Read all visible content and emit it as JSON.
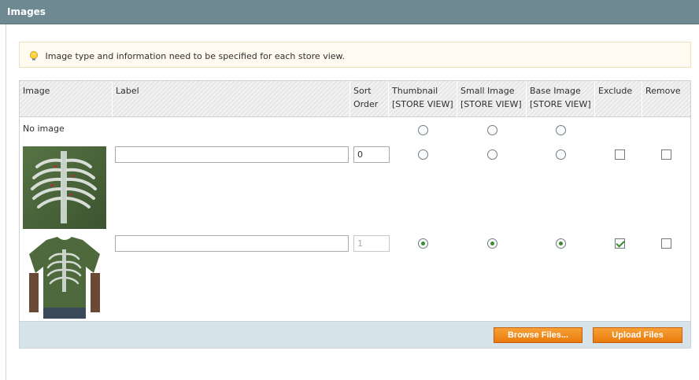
{
  "panel": {
    "title": "Images"
  },
  "notice": {
    "icon": "lightbulb-icon",
    "text": "Image type and information need to be specified for each store view."
  },
  "table": {
    "headers": {
      "image": "Image",
      "label": "Label",
      "sort_line1": "Sort",
      "sort_line2": "Order",
      "thumb_line1": "Thumbnail",
      "thumb_line2": "[STORE VIEW]",
      "small_line1": "Small Image",
      "small_line2": "[STORE VIEW]",
      "base_line1": "Base Image",
      "base_line2": "[STORE VIEW]",
      "exclude": "Exclude",
      "remove": "Remove"
    },
    "no_image_row": {
      "text": "No image",
      "thumbnail": false,
      "small_image": false,
      "base_image": false
    },
    "rows": [
      {
        "image": "ribcage-print-closeup",
        "label": "",
        "sort_order": "0",
        "sort_disabled": false,
        "thumbnail": false,
        "small_image": false,
        "base_image": false,
        "exclude": false,
        "remove": false
      },
      {
        "image": "green-tshirt-skeleton",
        "label": "",
        "sort_order": "1",
        "sort_disabled": true,
        "thumbnail": true,
        "small_image": true,
        "base_image": true,
        "exclude": true,
        "remove": false
      }
    ]
  },
  "buttons": {
    "browse": "Browse Files...",
    "upload": "Upload Files"
  },
  "colors": {
    "header_bg": "#6f8992",
    "button_orange": "#f18d23",
    "footer_bg": "#d6e3eb",
    "notice_bg": "#fffbf0"
  }
}
